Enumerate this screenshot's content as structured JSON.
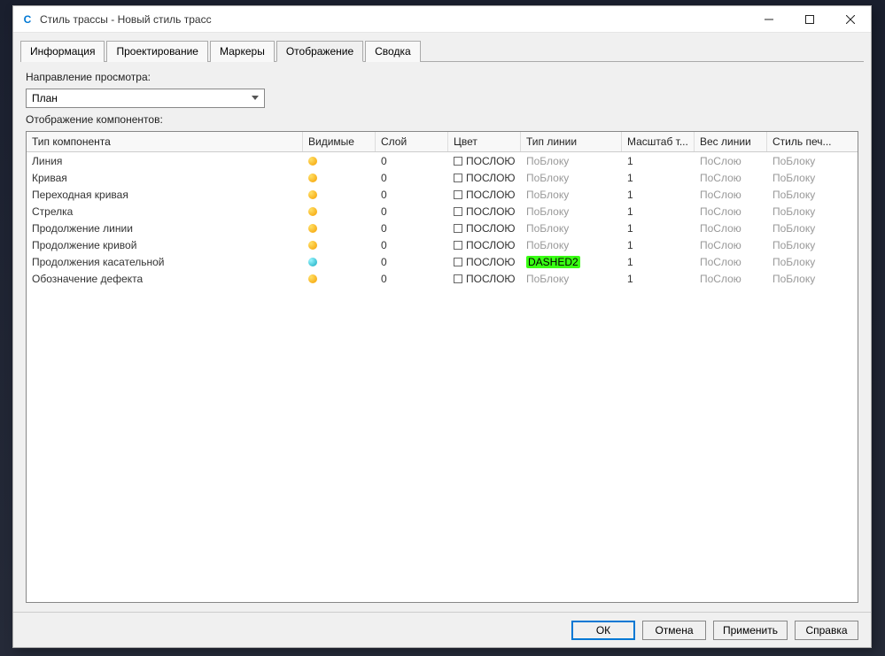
{
  "window": {
    "title": "Стиль трассы - Новый стиль трасс",
    "icon_label": "C"
  },
  "tabs": [
    {
      "label": "Информация"
    },
    {
      "label": "Проектирование"
    },
    {
      "label": "Маркеры"
    },
    {
      "label": "Отображение",
      "active": true
    },
    {
      "label": "Сводка"
    }
  ],
  "view_direction": {
    "label": "Направление просмотра:",
    "value": "План"
  },
  "components_label": "Отображение компонентов:",
  "table": {
    "headers": {
      "type": "Тип компонента",
      "visible": "Видимые",
      "layer": "Слой",
      "color": "Цвет",
      "linetype": "Тип линии",
      "scale": "Масштаб т...",
      "lineweight": "Вес линии",
      "plotstyle": "Стиль печ..."
    },
    "rows": [
      {
        "type": "Линия",
        "bulb": "yellow",
        "layer": "0",
        "color": "ПОСЛОЮ",
        "linetype": "ПоБлоку",
        "scale": "1",
        "lineweight": "ПоСлою",
        "plotstyle": "ПоБлоку"
      },
      {
        "type": "Кривая",
        "bulb": "yellow",
        "layer": "0",
        "color": "ПОСЛОЮ",
        "linetype": "ПоБлоку",
        "scale": "1",
        "lineweight": "ПоСлою",
        "plotstyle": "ПоБлоку"
      },
      {
        "type": "Переходная кривая",
        "bulb": "yellow",
        "layer": "0",
        "color": "ПОСЛОЮ",
        "linetype": "ПоБлоку",
        "scale": "1",
        "lineweight": "ПоСлою",
        "plotstyle": "ПоБлоку"
      },
      {
        "type": "Стрелка",
        "bulb": "yellow",
        "layer": "0",
        "color": "ПОСЛОЮ",
        "linetype": "ПоБлоку",
        "scale": "1",
        "lineweight": "ПоСлою",
        "plotstyle": "ПоБлоку"
      },
      {
        "type": "Продолжение линии",
        "bulb": "yellow",
        "layer": "0",
        "color": "ПОСЛОЮ",
        "linetype": "ПоБлоку",
        "scale": "1",
        "lineweight": "ПоСлою",
        "plotstyle": "ПоБлоку"
      },
      {
        "type": "Продолжение кривой",
        "bulb": "yellow",
        "layer": "0",
        "color": "ПОСЛОЮ",
        "linetype": "ПоБлоку",
        "scale": "1",
        "lineweight": "ПоСлою",
        "plotstyle": "ПоБлоку"
      },
      {
        "type": "Продолжения касательной",
        "bulb": "cyan",
        "layer": "0",
        "color": "ПОСЛОЮ",
        "linetype": "DASHED2",
        "highlight": true,
        "scale": "1",
        "lineweight": "ПоСлою",
        "plotstyle": "ПоБлоку"
      },
      {
        "type": "Обозначение дефекта",
        "bulb": "yellow",
        "layer": "0",
        "color": "ПОСЛОЮ",
        "linetype": "ПоБлоку",
        "scale": "1",
        "lineweight": "ПоСлою",
        "plotstyle": "ПоБлоку"
      }
    ]
  },
  "footer": {
    "ok": "ОК",
    "cancel": "Отмена",
    "apply": "Применить",
    "help": "Справка"
  }
}
